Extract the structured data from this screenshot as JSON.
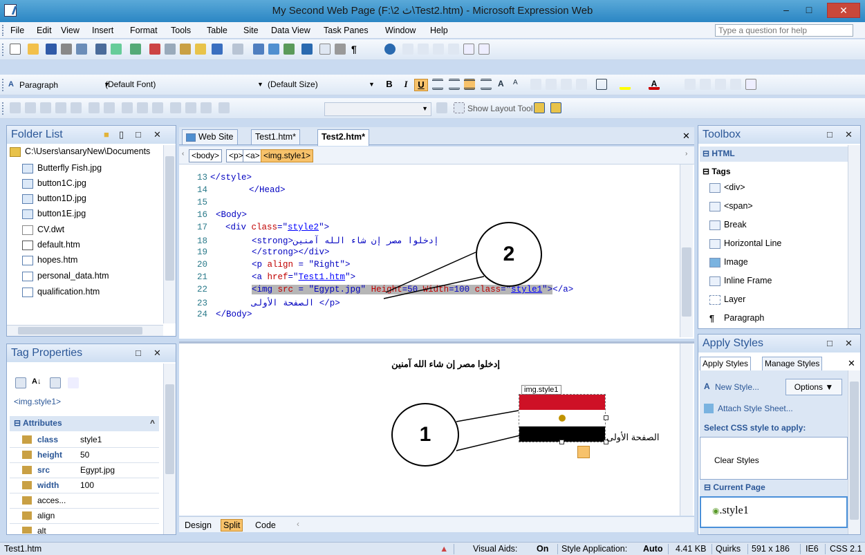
{
  "window": {
    "title": "My Second Web Page (F:\\2 ث\\Test2.htm) - Microsoft Expression Web",
    "minimize": "–",
    "maximize": "□",
    "close": "✕"
  },
  "menu": {
    "items": [
      "File",
      "Edit",
      "View",
      "Insert",
      "Format",
      "Tools",
      "Table",
      "Site",
      "Data View",
      "Task Panes",
      "Window",
      "Help"
    ],
    "help_placeholder": "Type a question for help"
  },
  "format_toolbar": {
    "style_label": "Paragraph",
    "font": "(Default Font)",
    "size": "(Default Size)",
    "bold": "B",
    "italic": "I",
    "underline": "U"
  },
  "layout_toolbar": {
    "show_layout_tool": "Show Layout Tool"
  },
  "folder_list": {
    "title": "Folder List",
    "root": "C:\\Users\\ansaryNew\\Documents",
    "files": [
      "Butterfly Fish.jpg",
      "button1C.jpg",
      "button1D.jpg",
      "button1E.jpg",
      "CV.dwt",
      "default.htm",
      "hopes.htm",
      "personal_data.htm",
      "qualification.htm"
    ]
  },
  "tag_properties": {
    "title": "Tag Properties",
    "current_tag": "<img.style1>",
    "section": "Attributes",
    "attributes": [
      {
        "name": "class",
        "value": "style1"
      },
      {
        "name": "height",
        "value": "50"
      },
      {
        "name": "src",
        "value": "Egypt.jpg"
      },
      {
        "name": "width",
        "value": "100"
      },
      {
        "name": "acces...",
        "value": ""
      },
      {
        "name": "align",
        "value": ""
      },
      {
        "name": "alt",
        "value": ""
      }
    ]
  },
  "doc_tabs": [
    "Web Site",
    "Test1.htm*",
    "Test2.htm*"
  ],
  "tag_selector": [
    "<body>",
    "<p>",
    "<a>",
    "<img.style1>"
  ],
  "code": {
    "line_numbers": [
      "13",
      "14",
      "15",
      "16",
      "17",
      "18",
      "19",
      "20",
      "21",
      "22",
      "23",
      "24"
    ],
    "l13": "</style>",
    "l14": "</Head>",
    "l16": "<Body>",
    "l17a": "<div ",
    "l17b": "class",
    "l17c": "=\"",
    "l17d": "style2",
    "l17e": "\">",
    "l18": "<strong>إدخلوا مصر إن شاء الله آمنين",
    "l19": "</strong></div>",
    "l20a": "<p ",
    "l20b": "align",
    "l20c": " = \"Right\">",
    "l21a": "<a ",
    "l21b": "href",
    "l21c": "=\"",
    "l21d": "Test1.htm",
    "l21e": "\">",
    "l22a": "<img ",
    "l22b": "src",
    "l22c": " = \"Egypt.jpg\" ",
    "l22d": "Height",
    "l22e": "=50 ",
    "l22f": "Width",
    "l22g": "=100 ",
    "l22h": "class",
    "l22i": "=\"",
    "l22j": "style1",
    "l22k": "\">",
    "l22l": "</a>",
    "l23": "الصفحة الأولى </p>",
    "l24": "</Body>"
  },
  "design": {
    "heading": "إدخلوا مصر إن شاء الله آمنين",
    "img_tag": "img.style1",
    "link_text": "الصفحة الأولى"
  },
  "callouts": {
    "one": "1",
    "two": "2"
  },
  "view_tabs": [
    "Design",
    "Split",
    "Code"
  ],
  "toolbox": {
    "title": "Toolbox",
    "section_html": "HTML",
    "section_tags": "Tags",
    "items": [
      "<div>",
      "<span>",
      "Break",
      "Horizontal Line",
      "Image",
      "Inline Frame",
      "Layer",
      "Paragraph"
    ]
  },
  "apply_styles": {
    "title": "Apply Styles",
    "tabs": [
      "Apply Styles",
      "Manage Styles"
    ],
    "new_style": "New Style...",
    "options": "Options ▼",
    "attach": "Attach Style Sheet...",
    "select_label": "Select CSS style to apply:",
    "clear": "Clear Styles",
    "current_page": "Current Page",
    "style_item": ".style1"
  },
  "status": {
    "file": "Test1.htm",
    "visual_aids_label": "Visual Aids:",
    "visual_aids_value": "On",
    "style_app_label": "Style Application:",
    "style_app_value": "Auto",
    "size": "4.41 KB",
    "mode": "Quirks",
    "dims": "591 x 186",
    "browser": "IE6",
    "css": "CSS 2.1"
  },
  "colors": {
    "accent": "#2b5797",
    "selected_tab": "#f7c26b",
    "flag_red": "#ce1126",
    "flag_black": "#000000"
  }
}
